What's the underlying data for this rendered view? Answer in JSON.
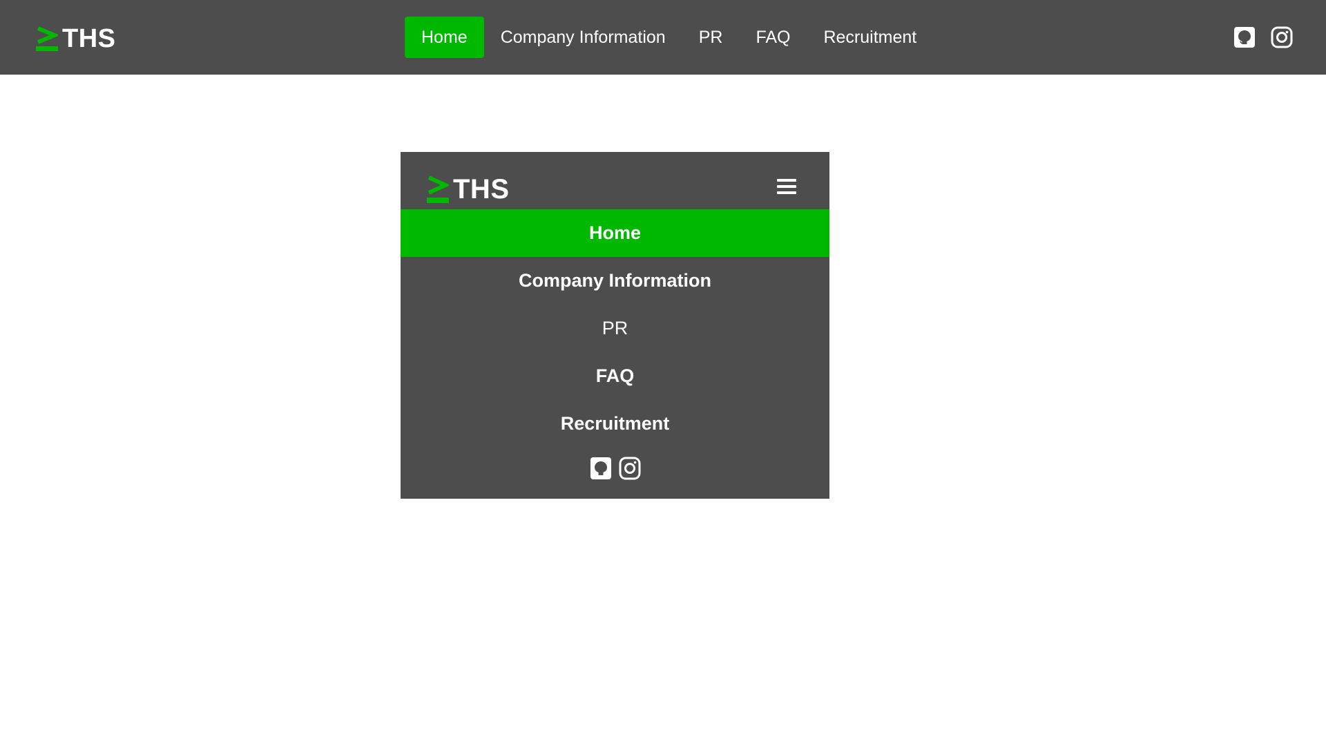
{
  "brand": {
    "name": "THS",
    "mark": "≥",
    "accent_color": "#00b800"
  },
  "colors": {
    "navbar_bg": "#4d4d4d",
    "active_bg": "#00b800",
    "text": "#ffffff",
    "page_bg": "#ffffff"
  },
  "topnav": {
    "links": [
      {
        "label": "Home",
        "active": true
      },
      {
        "label": "Company Information",
        "active": false
      },
      {
        "label": "PR",
        "active": false
      },
      {
        "label": "FAQ",
        "active": false
      },
      {
        "label": "Recruitment",
        "active": false
      }
    ],
    "social": [
      "github-icon",
      "instagram-icon"
    ]
  },
  "mobile": {
    "menu_icon": "hamburger-menu-icon",
    "links": [
      {
        "label": "Home",
        "active": true
      },
      {
        "label": "Company Information",
        "active": false
      },
      {
        "label": "PR",
        "active": false
      },
      {
        "label": "FAQ",
        "active": false
      },
      {
        "label": "Recruitment",
        "active": false
      }
    ],
    "social": [
      "github-icon",
      "instagram-icon"
    ]
  }
}
